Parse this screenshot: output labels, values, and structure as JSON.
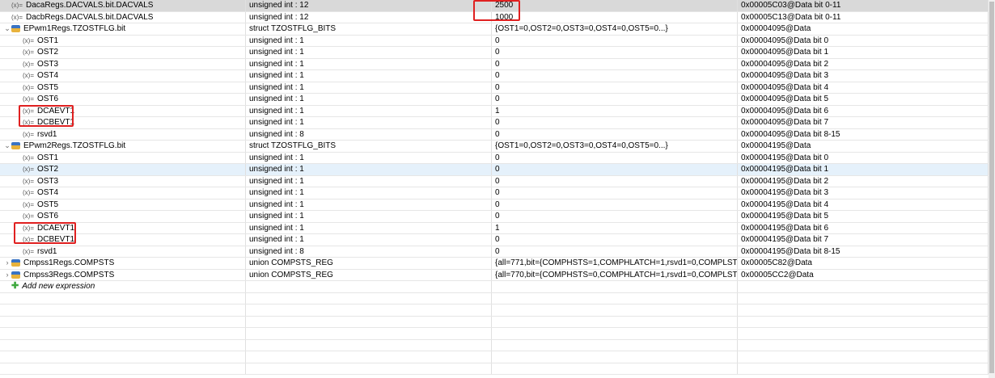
{
  "rows": [
    {
      "name": "DacaRegs.DACVALS.bit.DACVALS",
      "type": "unsigned int : 12",
      "value": "2500",
      "location": "0x00005C03@Data bit 0-11",
      "level": 0,
      "kind": "var",
      "state": "selected"
    },
    {
      "name": "DacbRegs.DACVALS.bit.DACVALS",
      "type": "unsigned int : 12",
      "value": "1000",
      "location": "0x00005C13@Data bit 0-11",
      "level": 0,
      "kind": "var"
    },
    {
      "name": "EPwm1Regs.TZOSTFLG.bit",
      "type": "struct TZOSTFLG_BITS",
      "value": "{OST1=0,OST2=0,OST3=0,OST4=0,OST5=0...}",
      "location": "0x00004095@Data",
      "level": 0,
      "kind": "struct",
      "expanded": true
    },
    {
      "name": "OST1",
      "type": "unsigned int : 1",
      "value": "0",
      "location": "0x00004095@Data bit 0",
      "level": 1,
      "kind": "var"
    },
    {
      "name": "OST2",
      "type": "unsigned int : 1",
      "value": "0",
      "location": "0x00004095@Data bit 1",
      "level": 1,
      "kind": "var"
    },
    {
      "name": "OST3",
      "type": "unsigned int : 1",
      "value": "0",
      "location": "0x00004095@Data bit 2",
      "level": 1,
      "kind": "var"
    },
    {
      "name": "OST4",
      "type": "unsigned int : 1",
      "value": "0",
      "location": "0x00004095@Data bit 3",
      "level": 1,
      "kind": "var"
    },
    {
      "name": "OST5",
      "type": "unsigned int : 1",
      "value": "0",
      "location": "0x00004095@Data bit 4",
      "level": 1,
      "kind": "var"
    },
    {
      "name": "OST6",
      "type": "unsigned int : 1",
      "value": "0",
      "location": "0x00004095@Data bit 5",
      "level": 1,
      "kind": "var"
    },
    {
      "name": "DCAEVT1",
      "type": "unsigned int : 1",
      "value": "1",
      "location": "0x00004095@Data bit 6",
      "level": 1,
      "kind": "var"
    },
    {
      "name": "DCBEVT1",
      "type": "unsigned int : 1",
      "value": "0",
      "location": "0x00004095@Data bit 7",
      "level": 1,
      "kind": "var"
    },
    {
      "name": "rsvd1",
      "type": "unsigned int : 8",
      "value": "0",
      "location": "0x00004095@Data bit 8-15",
      "level": 1,
      "kind": "var"
    },
    {
      "name": "EPwm2Regs.TZOSTFLG.bit",
      "type": "struct TZOSTFLG_BITS",
      "value": "{OST1=0,OST2=0,OST3=0,OST4=0,OST5=0...}",
      "location": "0x00004195@Data",
      "level": 0,
      "kind": "struct",
      "expanded": true
    },
    {
      "name": "OST1",
      "type": "unsigned int : 1",
      "value": "0",
      "location": "0x00004195@Data bit 0",
      "level": 1,
      "kind": "var"
    },
    {
      "name": "OST2",
      "type": "unsigned int : 1",
      "value": "0",
      "location": "0x00004195@Data bit 1",
      "level": 1,
      "kind": "var",
      "state": "hover"
    },
    {
      "name": "OST3",
      "type": "unsigned int : 1",
      "value": "0",
      "location": "0x00004195@Data bit 2",
      "level": 1,
      "kind": "var"
    },
    {
      "name": "OST4",
      "type": "unsigned int : 1",
      "value": "0",
      "location": "0x00004195@Data bit 3",
      "level": 1,
      "kind": "var"
    },
    {
      "name": "OST5",
      "type": "unsigned int : 1",
      "value": "0",
      "location": "0x00004195@Data bit 4",
      "level": 1,
      "kind": "var"
    },
    {
      "name": "OST6",
      "type": "unsigned int : 1",
      "value": "0",
      "location": "0x00004195@Data bit 5",
      "level": 1,
      "kind": "var"
    },
    {
      "name": "DCAEVT1",
      "type": "unsigned int : 1",
      "value": "1",
      "location": "0x00004195@Data bit 6",
      "level": 1,
      "kind": "var"
    },
    {
      "name": "DCBEVT1",
      "type": "unsigned int : 1",
      "value": "0",
      "location": "0x00004195@Data bit 7",
      "level": 1,
      "kind": "var"
    },
    {
      "name": "rsvd1",
      "type": "unsigned int : 8",
      "value": "0",
      "location": "0x00004195@Data bit 8-15",
      "level": 1,
      "kind": "var"
    },
    {
      "name": "Cmpss1Regs.COMPSTS",
      "type": "union COMPSTS_REG",
      "value": "{all=771,bit={COMPHSTS=1,COMPHLATCH=1,rsvd1=0,COMPLSTS=1,...",
      "location": "0x00005C82@Data",
      "level": 0,
      "kind": "struct",
      "expanded": false
    },
    {
      "name": "Cmpss3Regs.COMPSTS",
      "type": "union COMPSTS_REG",
      "value": "{all=770,bit={COMPHSTS=0,COMPHLATCH=1,rsvd1=0,COMPLSTS=1,...",
      "location": "0x00005CC2@Data",
      "level": 0,
      "kind": "struct",
      "expanded": false
    }
  ],
  "add_expression_label": "Add new expression",
  "highlight_color": "#e02020"
}
